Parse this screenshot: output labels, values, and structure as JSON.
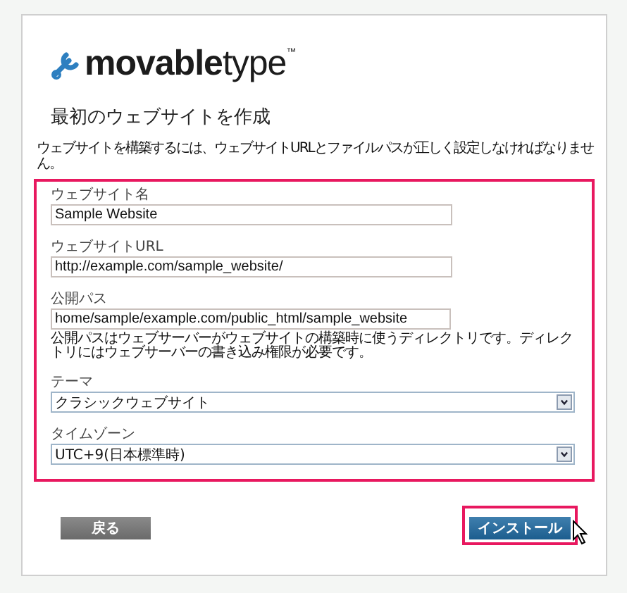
{
  "logo": "**movable**type$^{™}$",
  "heading": "最初のウェブサイトを作成",
  "intro": "ウェブサイトを構築するには、ウェブサイトURLとファイルパスが正しく設定しなければなりません。",
  "fields": [
    {
      "kind": "text",
      "label": "ウェブサイト名",
      "value": "Sample Website"
    },
    {
      "kind": "text",
      "label": "ウェブサイトURL",
      "value": "http://example.com/sample_website/"
    },
    {
      "kind": "text",
      "label": "公開パス",
      "value": "home/sample/example.com/public_html/sample_website",
      "note": "公開パスはウェブサーバーがウェブサイトの構築時に使うディレクトリです。ディレクトリにはウェブサーバーの書き込み権限が必要です。"
    },
    {
      "kind": "select",
      "label": "テーマ",
      "value": "クラシックウェブサイト"
    },
    {
      "kind": "select",
      "label": "タイムゾーン",
      "value": "UTC+9(日本標準時)"
    }
  ],
  "buttons": [
    {
      "kind": "secondary",
      "label": "戻る",
      "highlighted": false
    },
    {
      "kind": "primary",
      "label": "インストール",
      "highlighted": true
    }
  ]
}
